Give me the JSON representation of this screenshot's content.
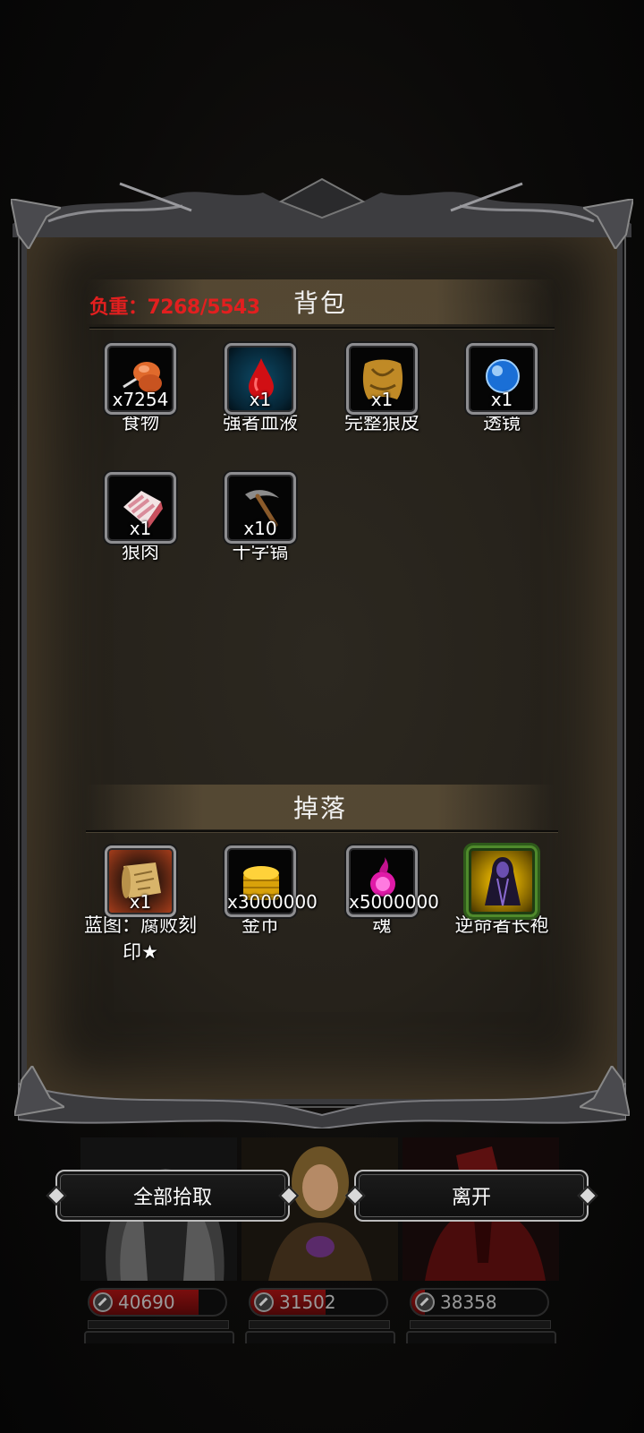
{
  "inventory": {
    "weight_label": "负重：7268/5543",
    "title": "背包",
    "items": [
      {
        "name": "食物",
        "qty": "x7254",
        "icon": "food-drumstick-icon"
      },
      {
        "name": "强者血液",
        "qty": "x1",
        "icon": "blood-drop-icon"
      },
      {
        "name": "完整狼皮",
        "qty": "x1",
        "icon": "wolf-pelt-icon"
      },
      {
        "name": "透镜",
        "qty": "x1",
        "icon": "blue-lens-orb-icon"
      },
      {
        "name": "狼肉",
        "qty": "x1",
        "icon": "raw-meat-icon"
      },
      {
        "name": "十字镐",
        "qty": "x10",
        "icon": "pickaxe-icon"
      }
    ]
  },
  "drops": {
    "title": "掉落",
    "items": [
      {
        "name": "蓝图：腐败刻印★",
        "qty": "x1",
        "icon": "blueprint-scroll-icon"
      },
      {
        "name": "金币",
        "qty": "x3000000",
        "icon": "gold-coins-icon"
      },
      {
        "name": "魂",
        "qty": "x5000000",
        "icon": "soul-flame-icon"
      },
      {
        "name": "逆命者长袍",
        "qty": "",
        "icon": "hooded-robe-icon"
      }
    ]
  },
  "buttons": {
    "pick_all": "全部拾取",
    "leave": "离开"
  },
  "heroes": [
    {
      "hp": "40690",
      "hp_fraction": 0.8
    },
    {
      "hp": "31502",
      "hp_fraction": 0.55
    },
    {
      "hp": "38358",
      "hp_fraction": 0.1
    }
  ],
  "colors": {
    "weight_text": "#e21f1f",
    "panel_frame": "#3a3a3d",
    "hp_fill": "#7b0e0e"
  }
}
